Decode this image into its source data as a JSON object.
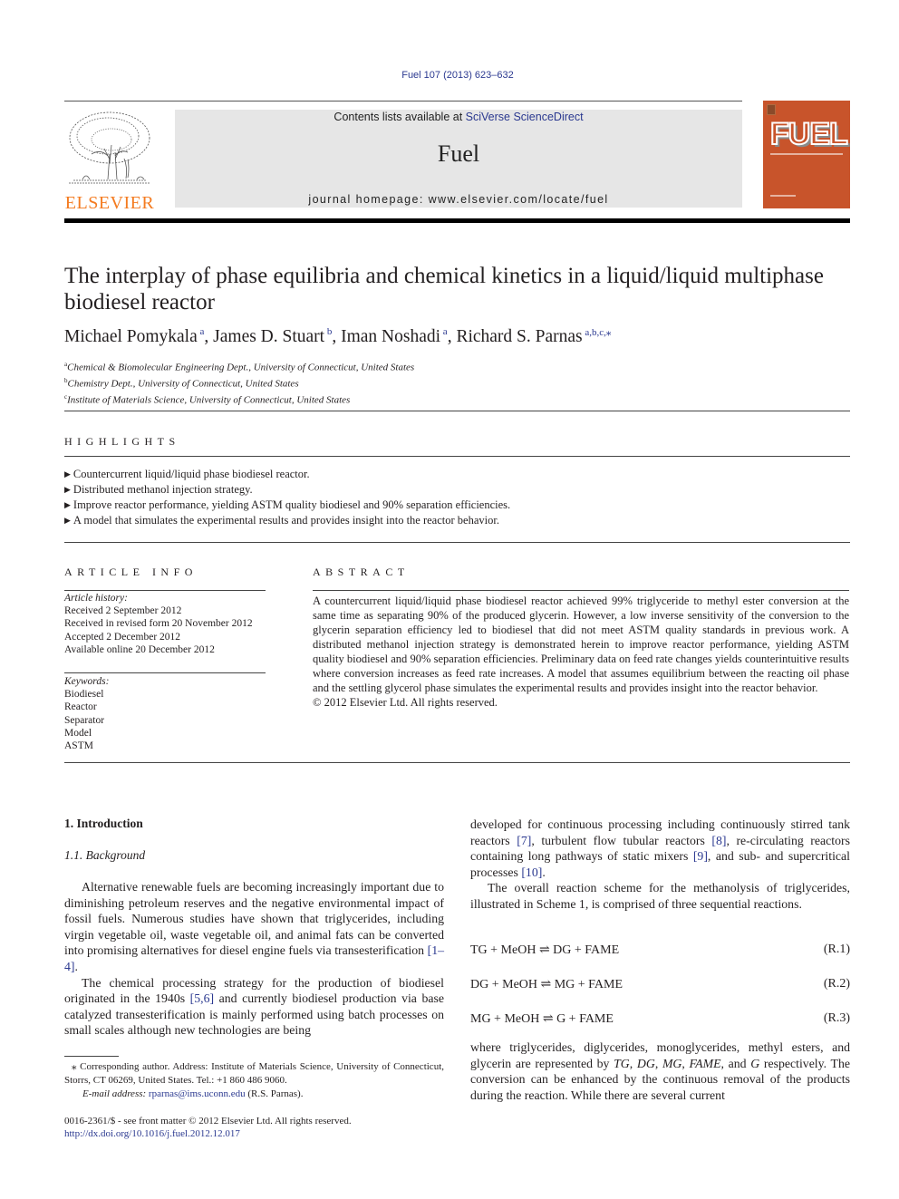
{
  "header": {
    "journal_ref": "Fuel 107 (2013) 623–632",
    "contents_prefix": "Contents lists available at ",
    "contents_link": "SciVerse ScienceDirect",
    "journal_title": "Fuel",
    "homepage": "journal homepage: www.elsevier.com/locate/fuel",
    "publisher_logo_text": "ELSEVIER",
    "cover_title": "FUEL",
    "colors": {
      "publisher_orange": "#f47b20",
      "cover_bg": "#c8542b",
      "link_blue": "#2b3990"
    }
  },
  "article": {
    "title": "The interplay of phase equilibria and chemical kinetics in a liquid/liquid multiphase biodiesel reactor",
    "authors": [
      {
        "name": "Michael Pomykala",
        "sup": "a",
        "sep": ", "
      },
      {
        "name": "James D. Stuart",
        "sup": "b",
        "sep": ", "
      },
      {
        "name": "Iman Noshadi",
        "sup": "a",
        "sep": ", "
      },
      {
        "name": "Richard S. Parnas",
        "sup": "a,b,c,⁎",
        "sep": ""
      }
    ],
    "affiliations": [
      {
        "key": "a",
        "text": "Chemical & Biomolecular Engineering Dept., University of Connecticut, United States"
      },
      {
        "key": "b",
        "text": "Chemistry Dept., University of Connecticut, United States"
      },
      {
        "key": "c",
        "text": "Institute of Materials Science, University of Connecticut, United States"
      }
    ]
  },
  "highlights": {
    "label": "HIGHLIGHTS",
    "items": [
      "Countercurrent liquid/liquid phase biodiesel reactor.",
      "Distributed methanol injection strategy.",
      "Improve reactor performance, yielding ASTM quality biodiesel and 90% separation efficiencies.",
      "A model that simulates the experimental results and provides insight into the reactor behavior."
    ]
  },
  "article_info": {
    "label": "ARTICLE INFO",
    "history_label": "Article history:",
    "history": [
      "Received 2 September 2012",
      "Received in revised form 20 November 2012",
      "Accepted 2 December 2012",
      "Available online 20 December 2012"
    ],
    "keywords_label": "Keywords:",
    "keywords": [
      "Biodiesel",
      "Reactor",
      "Separator",
      "Model",
      "ASTM"
    ]
  },
  "abstract": {
    "label": "ABSTRACT",
    "text": "A countercurrent liquid/liquid phase biodiesel reactor achieved 99% triglyceride to methyl ester conversion at the same time as separating 90% of the produced glycerin. However, a low inverse sensitivity of the conversion to the glycerin separation efficiency led to biodiesel that did not meet ASTM quality standards in previous work. A distributed methanol injection strategy is demonstrated herein to improve reactor performance, yielding ASTM quality biodiesel and 90% separation efficiencies. Preliminary data on feed rate changes yields counterintuitive results where conversion increases as feed rate increases. A model that assumes equilibrium between the reacting oil phase and the settling glycerol phase simulates the experimental results and provides insight into the reactor behavior.",
    "copyright": "© 2012 Elsevier Ltd. All rights reserved."
  },
  "body": {
    "section_heading": "1. Introduction",
    "subsection_heading": "1.1. Background",
    "left_paragraphs": [
      {
        "parts": [
          {
            "t": "Alternative renewable fuels are becoming increasingly important due to diminishing petroleum reserves and the negative environmental impact of fossil fuels. Numerous studies have shown that triglycerides, including virgin vegetable oil, waste vegetable oil, and animal fats can be converted into promising alternatives for diesel engine fuels via transesterification "
          },
          {
            "t": "[1–4]",
            "link": true
          },
          {
            "t": "."
          }
        ]
      },
      {
        "parts": [
          {
            "t": "The chemical processing strategy for the production of biodiesel originated in the 1940s "
          },
          {
            "t": "[5,6]",
            "link": true
          },
          {
            "t": " and currently biodiesel production via base catalyzed transesterification is mainly performed using batch processes on small scales although new technologies are being"
          }
        ]
      }
    ],
    "right_paragraph_1": {
      "parts": [
        {
          "t": "developed for continuous processing including continuously stirred tank reactors "
        },
        {
          "t": "[7]",
          "link": true
        },
        {
          "t": ", turbulent flow tubular reactors "
        },
        {
          "t": "[8]",
          "link": true
        },
        {
          "t": ", re-circulating reactors containing long pathways of static mixers "
        },
        {
          "t": "[9]",
          "link": true
        },
        {
          "t": ", and sub- and supercritical processes "
        },
        {
          "t": "[10]",
          "link": true
        },
        {
          "t": "."
        }
      ]
    },
    "right_paragraph_2": "The overall reaction scheme for the methanolysis of triglycerides, illustrated in Scheme 1, is comprised of three sequential reactions.",
    "equations": [
      {
        "expr": "TG + MeOH ⇌ DG + FAME",
        "num": "(R.1)"
      },
      {
        "expr": "DG + MeOH ⇌ MG + FAME",
        "num": "(R.2)"
      },
      {
        "expr": "MG + MeOH ⇌ G + FAME",
        "num": "(R.3)"
      }
    ],
    "right_paragraph_3": {
      "parts": [
        {
          "t": "where triglycerides, diglycerides, monoglycerides, methyl esters, and glycerin are represented by "
        },
        {
          "t": "TG",
          "i": true
        },
        {
          "t": ", "
        },
        {
          "t": "DG",
          "i": true
        },
        {
          "t": ", "
        },
        {
          "t": "MG",
          "i": true
        },
        {
          "t": ", "
        },
        {
          "t": "FAME",
          "i": true
        },
        {
          "t": ", and "
        },
        {
          "t": "G",
          "i": true
        },
        {
          "t": " respectively. The conversion can be enhanced by the continuous removal of the products during the reaction. While there are several current"
        }
      ]
    }
  },
  "footnotes": {
    "corresponding": "⁎ Corresponding author. Address: Institute of Materials Science, University of Connecticut, Storrs, CT 06269, United States. Tel.: +1 860 486 9060.",
    "email_label": "E-mail address: ",
    "email": "rparnas@ims.uconn.edu",
    "email_suffix": " (R.S. Parnas).",
    "front_matter": "0016-2361/$ - see front matter © 2012 Elsevier Ltd. All rights reserved.",
    "doi": "http://dx.doi.org/10.1016/j.fuel.2012.12.017"
  }
}
